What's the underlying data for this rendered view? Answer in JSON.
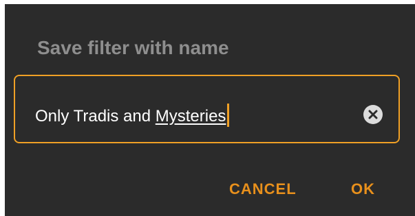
{
  "dialog": {
    "title": "Save filter with name",
    "input": {
      "prefix": "Only Tradis and ",
      "underlined_word": "Mysteries"
    },
    "clear_icon": "clear-circle-icon",
    "buttons": {
      "cancel_label": "CANCEL",
      "ok_label": "OK"
    }
  },
  "colors": {
    "background": "#2b2b2b",
    "accent": "#f0a025",
    "title": "#8e8e8e",
    "input_text": "#ffffff"
  }
}
